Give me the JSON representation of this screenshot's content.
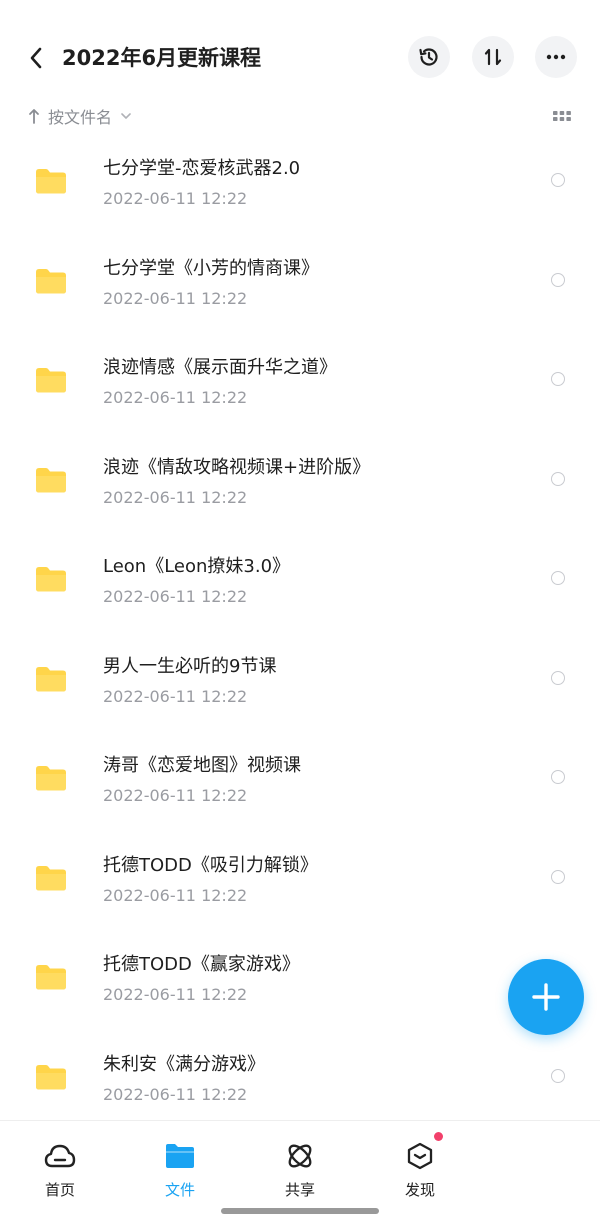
{
  "header": {
    "title": "2022年6月更新课程",
    "icons": [
      "back-arrow-icon",
      "history-icon",
      "sort-swap-icon",
      "more-icon"
    ]
  },
  "sort": {
    "label": "按文件名",
    "icons": [
      "arrow-up-icon",
      "chevron-down-icon",
      "grid-view-icon"
    ]
  },
  "colors": {
    "folder": "#ffd54a",
    "accent": "#1aa3f2",
    "badge": "#f2406b"
  },
  "files": [
    {
      "name": "七分学堂-恋爱核武器2.0",
      "date": "2022-06-11  12:22"
    },
    {
      "name": "七分学堂《小芳的情商课》",
      "date": "2022-06-11  12:22"
    },
    {
      "name": "浪迹情感《展示面升华之道》",
      "date": "2022-06-11  12:22"
    },
    {
      "name": "浪迹《情敌攻略视频课+进阶版》",
      "date": "2022-06-11  12:22"
    },
    {
      "name": "Leon《Leon撩妹3.0》",
      "date": "2022-06-11  12:22"
    },
    {
      "name": "男人一生必听的9节课",
      "date": "2022-06-11  12:22"
    },
    {
      "name": "涛哥《恋爱地图》视频课",
      "date": "2022-06-11  12:22"
    },
    {
      "name": "托德TODD《吸引力解锁》",
      "date": "2022-06-11  12:22"
    },
    {
      "name": "托德TODD《赢家游戏》",
      "date": "2022-06-11  12:22"
    },
    {
      "name": "朱利安《满分游戏》",
      "date": "2022-06-11  12:22"
    }
  ],
  "tabs": [
    {
      "label": "首页",
      "icon": "cloud-icon"
    },
    {
      "label": "文件",
      "icon": "folder-icon",
      "active": true
    },
    {
      "label": "共享",
      "icon": "atom-icon"
    },
    {
      "label": "发现",
      "icon": "discover-box-icon",
      "badge": true
    }
  ]
}
